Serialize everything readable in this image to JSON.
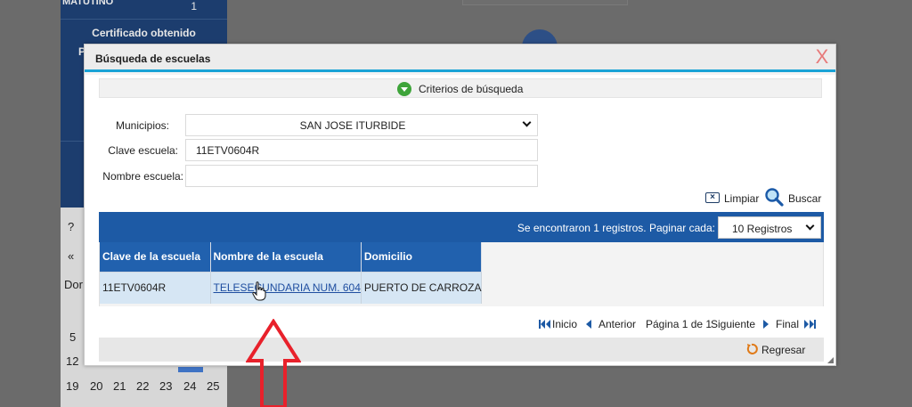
{
  "background": {
    "sidebar": {
      "shift_label": "MATUTINO",
      "shift_count": "1",
      "certificate_heading": "Certificado obtenido",
      "clipped_text": "P"
    },
    "calendar": {
      "help": "?",
      "prev": "«",
      "day_abbr": "Dor",
      "rows": [
        {
          "cells": [
            "5"
          ]
        },
        {
          "cells": [
            "12"
          ]
        },
        {
          "cells": [
            "19",
            "20",
            "21",
            "22",
            "23",
            "24",
            "25"
          ]
        }
      ]
    }
  },
  "modal": {
    "title": "Búsqueda de escuelas",
    "close_label": "X",
    "criteria_label": "Criterios de búsqueda",
    "form": {
      "municipios_label": "Municipios:",
      "municipios_value": "SAN JOSE ITURBIDE",
      "clave_label": "Clave escuela:",
      "clave_value": "11ETV0604R",
      "nombre_label": "Nombre escuela:",
      "nombre_value": ""
    },
    "actions": {
      "limpiar": "Limpiar",
      "buscar": "Buscar"
    },
    "results": {
      "summary": "Se encontraron 1 registros. Paginar cada:",
      "page_size": "10 Registros",
      "columns": [
        "Clave de la escuela",
        "Nombre de la escuela",
        "Domicilio"
      ],
      "rows": [
        {
          "clave": "11ETV0604R",
          "nombre": "TELESECUNDARIA NUM. 604",
          "domicilio": "PUERTO DE CARROZA"
        }
      ]
    },
    "pager": {
      "first": "Inicio",
      "prev": "Anterior",
      "page_info": "Página 1 de 1",
      "next": "Siguiente",
      "last": "Final"
    },
    "footer": {
      "regresar": "Regresar"
    }
  },
  "colors": {
    "accent_blue": "#1d5aa5",
    "header_underline": "#1aa3d6",
    "close_red": "#e77a7a",
    "annotation_red": "#e8212b"
  }
}
